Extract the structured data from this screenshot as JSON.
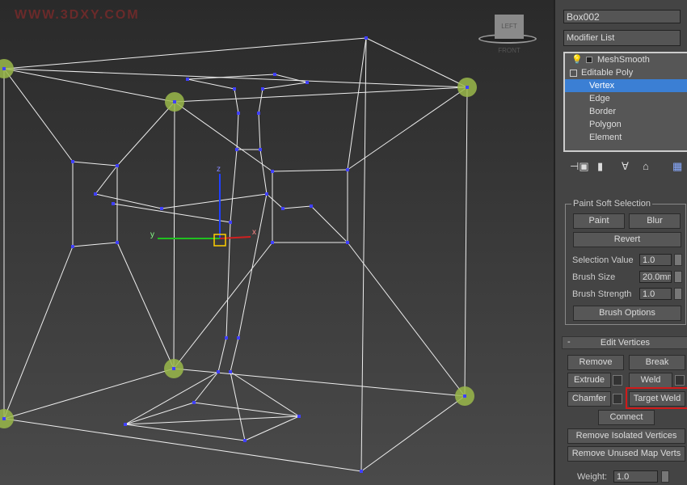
{
  "viewport": {
    "watermark": "WWW.3DXY.COM",
    "viewcube_label": "LEFT FRONT",
    "axis_labels": {
      "x": "x",
      "y": "y",
      "z": "z"
    },
    "vertex_color": "#4040ff",
    "soft_sel_color": "#9ab84a"
  },
  "panel": {
    "object_name": "Box002",
    "modifier_list": "Modifier List",
    "stack": [
      {
        "label": "MeshSmooth"
      },
      {
        "label": "Editable Poly"
      },
      {
        "label": "Vertex",
        "selected": true
      },
      {
        "label": "Edge"
      },
      {
        "label": "Border"
      },
      {
        "label": "Polygon"
      },
      {
        "label": "Element"
      }
    ],
    "toolbar_icons": [
      "pin-stack-icon",
      "show-end-result-icon",
      "make-unique-icon",
      "remove-modifier-icon",
      "configure-modifier-sets-icon"
    ],
    "paint_soft": {
      "title": "Paint Soft Selection",
      "paint": "Paint",
      "blur": "Blur",
      "revert": "Revert",
      "selection_value_label": "Selection Value",
      "selection_value": "1.0",
      "brush_size_label": "Brush Size",
      "brush_size": "20.0mm",
      "brush_strength_label": "Brush Strength",
      "brush_strength": "1.0",
      "brush_options": "Brush Options"
    },
    "edit_vertices": {
      "collapse": "-",
      "title": "Edit Vertices",
      "remove": "Remove",
      "break": "Break",
      "extrude": "Extrude",
      "weld": "Weld",
      "chamfer": "Chamfer",
      "target_weld": "Target Weld",
      "connect": "Connect",
      "remove_isolated": "Remove Isolated Vertices",
      "remove_unused": "Remove Unused Map Verts",
      "weight_label": "Weight:",
      "weight": "1.0"
    },
    "highlight_color": "#d01a1a"
  }
}
